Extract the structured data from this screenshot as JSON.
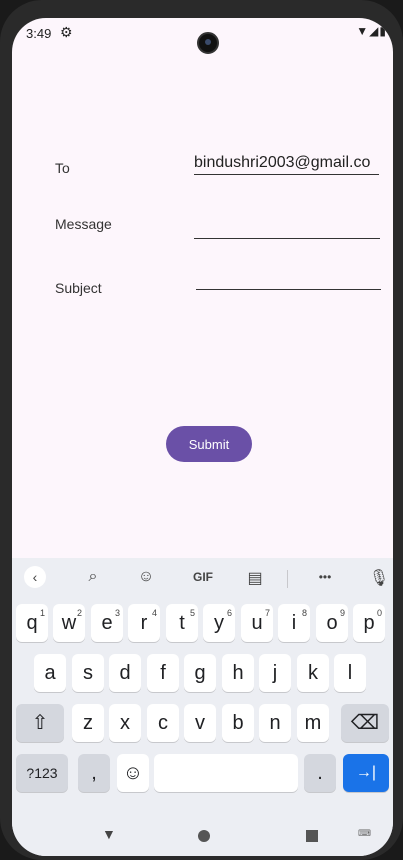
{
  "status": {
    "time": "3:49",
    "gear_icon": "gear-icon",
    "right_icons": "▼◢▮"
  },
  "form": {
    "to_label": "To",
    "to_value": "bindushri2003@gmail.co",
    "message_label": "Message",
    "message_value": "",
    "subject_label": "Subject",
    "subject_value": "",
    "submit_label": "Submit"
  },
  "keyboard": {
    "toolbar": {
      "back": "‹",
      "search": "⌕",
      "emoji": "☺",
      "gif": "GIF",
      "clipboard": "▤",
      "more": "•••",
      "mic": "🎙"
    },
    "row1": [
      "q",
      "w",
      "e",
      "r",
      "t",
      "y",
      "u",
      "i",
      "o",
      "p"
    ],
    "row1_nums": [
      "1",
      "2",
      "3",
      "4",
      "5",
      "6",
      "7",
      "8",
      "9",
      "0"
    ],
    "row2": [
      "a",
      "s",
      "d",
      "f",
      "g",
      "h",
      "j",
      "k",
      "l"
    ],
    "row3": [
      "z",
      "x",
      "c",
      "v",
      "b",
      "n",
      "m"
    ],
    "shift": "⇧",
    "backspace": "⌫",
    "sym": "?123",
    "comma": ",",
    "emoji_key": "☺",
    "space": "",
    "period": ".",
    "enter": "→|"
  },
  "nav": {
    "back": "▼",
    "keyboard": "⌨"
  }
}
